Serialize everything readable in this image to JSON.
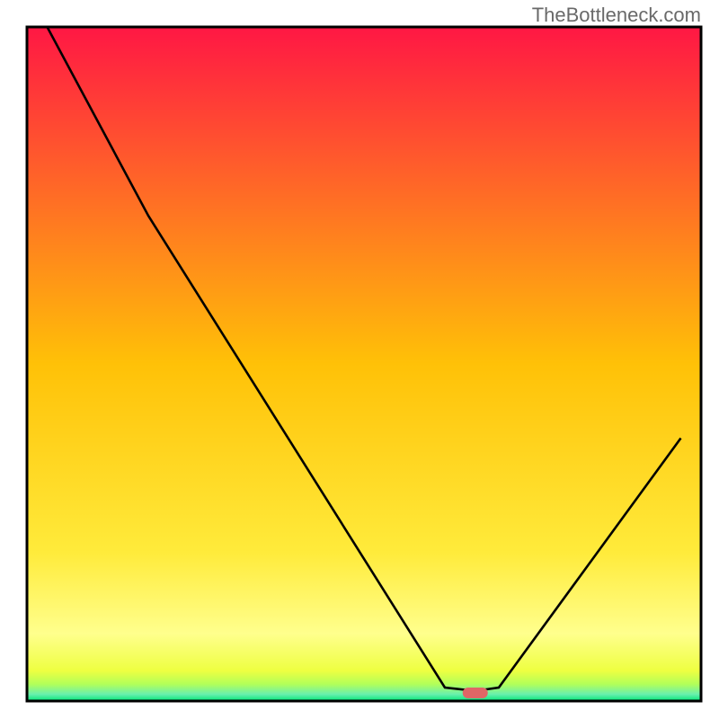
{
  "watermark": "TheBottleneck.com",
  "chart_data": {
    "type": "line",
    "title": "",
    "xlabel": "",
    "ylabel": "",
    "xlim": [
      0,
      100
    ],
    "ylim": [
      0,
      100
    ],
    "series": [
      {
        "name": "curve",
        "x": [
          3,
          18,
          62,
          66.5,
          70,
          97
        ],
        "values": [
          100,
          72,
          2,
          1.5,
          2,
          39
        ]
      }
    ],
    "marker": {
      "x": 66.5,
      "y": 1.2,
      "color": "#e06666"
    },
    "gradient_stops": [
      {
        "offset": 0.0,
        "color": "#ff1744"
      },
      {
        "offset": 0.5,
        "color": "#ffc107"
      },
      {
        "offset": 0.78,
        "color": "#ffeb3b"
      },
      {
        "offset": 0.9,
        "color": "#ffff8d"
      },
      {
        "offset": 0.955,
        "color": "#eeff41"
      },
      {
        "offset": 0.975,
        "color": "#b2ff59"
      },
      {
        "offset": 0.99,
        "color": "#69f0ae"
      },
      {
        "offset": 1.0,
        "color": "#00e676"
      }
    ]
  }
}
